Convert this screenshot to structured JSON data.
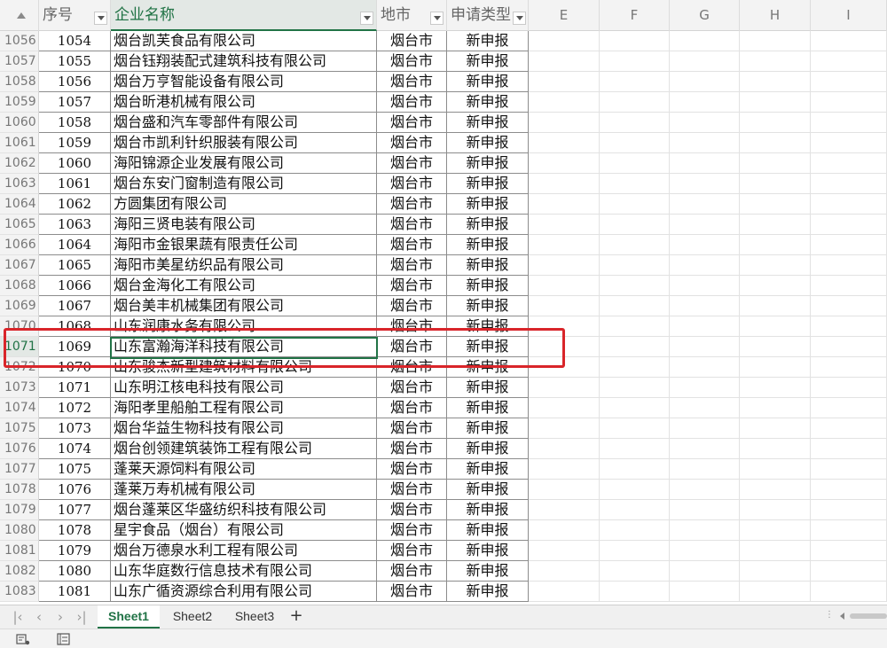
{
  "columns": {
    "A": {
      "header": "序号"
    },
    "B": {
      "header": "企业名称"
    },
    "C": {
      "header": "地市"
    },
    "D": {
      "header": "申请类型"
    },
    "letters": [
      "E",
      "F",
      "G",
      "H",
      "I"
    ]
  },
  "rows": [
    {
      "row": "1056",
      "seq": "1054",
      "name": "烟台凯芙食品有限公司",
      "city": "烟台市",
      "type": "新申报"
    },
    {
      "row": "1057",
      "seq": "1055",
      "name": "烟台钰翔装配式建筑科技有限公司",
      "city": "烟台市",
      "type": "新申报"
    },
    {
      "row": "1058",
      "seq": "1056",
      "name": "烟台万亨智能设备有限公司",
      "city": "烟台市",
      "type": "新申报"
    },
    {
      "row": "1059",
      "seq": "1057",
      "name": "烟台昕港机械有限公司",
      "city": "烟台市",
      "type": "新申报"
    },
    {
      "row": "1060",
      "seq": "1058",
      "name": "烟台盛和汽车零部件有限公司",
      "city": "烟台市",
      "type": "新申报"
    },
    {
      "row": "1061",
      "seq": "1059",
      "name": "烟台市凯利针织服装有限公司",
      "city": "烟台市",
      "type": "新申报"
    },
    {
      "row": "1062",
      "seq": "1060",
      "name": "海阳锦源企业发展有限公司",
      "city": "烟台市",
      "type": "新申报"
    },
    {
      "row": "1063",
      "seq": "1061",
      "name": "烟台东安门窗制造有限公司",
      "city": "烟台市",
      "type": "新申报"
    },
    {
      "row": "1064",
      "seq": "1062",
      "name": "方圆集团有限公司",
      "city": "烟台市",
      "type": "新申报"
    },
    {
      "row": "1065",
      "seq": "1063",
      "name": "海阳三贤电装有限公司",
      "city": "烟台市",
      "type": "新申报"
    },
    {
      "row": "1066",
      "seq": "1064",
      "name": "海阳市金银果蔬有限责任公司",
      "city": "烟台市",
      "type": "新申报"
    },
    {
      "row": "1067",
      "seq": "1065",
      "name": "海阳市美星纺织品有限公司",
      "city": "烟台市",
      "type": "新申报"
    },
    {
      "row": "1068",
      "seq": "1066",
      "name": "烟台金海化工有限公司",
      "city": "烟台市",
      "type": "新申报"
    },
    {
      "row": "1069",
      "seq": "1067",
      "name": "烟台美丰机械集团有限公司",
      "city": "烟台市",
      "type": "新申报"
    },
    {
      "row": "1070",
      "seq": "1068",
      "name": "山东润康水务有限公司",
      "city": "烟台市",
      "type": "新申报"
    },
    {
      "row": "1071",
      "seq": "1069",
      "name": "山东富瀚海洋科技有限公司",
      "city": "烟台市",
      "type": "新申报"
    },
    {
      "row": "1072",
      "seq": "1070",
      "name": "山东骏杰新型建筑材料有限公司",
      "city": "烟台市",
      "type": "新申报"
    },
    {
      "row": "1073",
      "seq": "1071",
      "name": "山东明江核电科技有限公司",
      "city": "烟台市",
      "type": "新申报"
    },
    {
      "row": "1074",
      "seq": "1072",
      "name": "海阳孝里船舶工程有限公司",
      "city": "烟台市",
      "type": "新申报"
    },
    {
      "row": "1075",
      "seq": "1073",
      "name": "烟台华益生物科技有限公司",
      "city": "烟台市",
      "type": "新申报"
    },
    {
      "row": "1076",
      "seq": "1074",
      "name": "烟台创领建筑装饰工程有限公司",
      "city": "烟台市",
      "type": "新申报"
    },
    {
      "row": "1077",
      "seq": "1075",
      "name": "蓬莱天源饲料有限公司",
      "city": "烟台市",
      "type": "新申报"
    },
    {
      "row": "1078",
      "seq": "1076",
      "name": "蓬莱万寿机械有限公司",
      "city": "烟台市",
      "type": "新申报"
    },
    {
      "row": "1079",
      "seq": "1077",
      "name": "烟台蓬莱区华盛纺织科技有限公司",
      "city": "烟台市",
      "type": "新申报"
    },
    {
      "row": "1080",
      "seq": "1078",
      "name": "星宇食品（烟台）有限公司",
      "city": "烟台市",
      "type": "新申报"
    },
    {
      "row": "1081",
      "seq": "1079",
      "name": "烟台万德泉水利工程有限公司",
      "city": "烟台市",
      "type": "新申报"
    },
    {
      "row": "1082",
      "seq": "1080",
      "name": "山东华庭数行信息技术有限公司",
      "city": "烟台市",
      "type": "新申报"
    },
    {
      "row": "1083",
      "seq": "1081",
      "name": "山东广循资源综合利用有限公司",
      "city": "烟台市",
      "type": "新申报"
    }
  ],
  "selected_row": "1071",
  "sheet_tabs": [
    "Sheet1",
    "Sheet2",
    "Sheet3"
  ],
  "active_tab": "Sheet1",
  "add_sheet_label": "+",
  "nav_icons": [
    "first-sheet-icon",
    "prev-sheet-icon",
    "next-sheet-icon",
    "last-sheet-icon"
  ],
  "colors": {
    "accent": "#217346",
    "highlight_box": "#d9252a"
  }
}
